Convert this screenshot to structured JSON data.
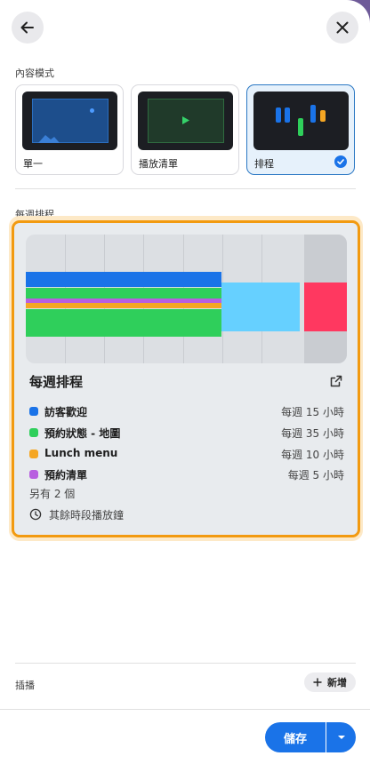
{
  "content_mode": {
    "label": "內容模式",
    "options": [
      {
        "name": "單一",
        "selected": false
      },
      {
        "name": "播放清單",
        "selected": false
      },
      {
        "name": "排程",
        "selected": true
      }
    ]
  },
  "weekly": {
    "section_label": "每週排程",
    "title": "每週排程",
    "items": [
      {
        "name": "訪客歡迎",
        "hours": "每週 15 小時",
        "color": "#1a73e8"
      },
      {
        "name": "預約狀態 - 地圖",
        "hours": "每週 35 小時",
        "color": "#2fcf5b"
      },
      {
        "name": "Lunch menu",
        "hours": "每週 10 小時",
        "color": "#f5a623"
      },
      {
        "name": "預約清單",
        "hours": "每週 5 小時",
        "color": "#b85fe0"
      }
    ],
    "more": "另有 2 個",
    "fallback": "其餘時段播放鐘"
  },
  "interstitial": {
    "label": "插播",
    "add_label": "新增"
  },
  "footer": {
    "save_label": "儲存"
  },
  "colors": {
    "accent": "#1a73e8",
    "highlight_border": "#f29a10",
    "light_blue_block": "#66d0ff",
    "red_block": "#ff3860"
  }
}
